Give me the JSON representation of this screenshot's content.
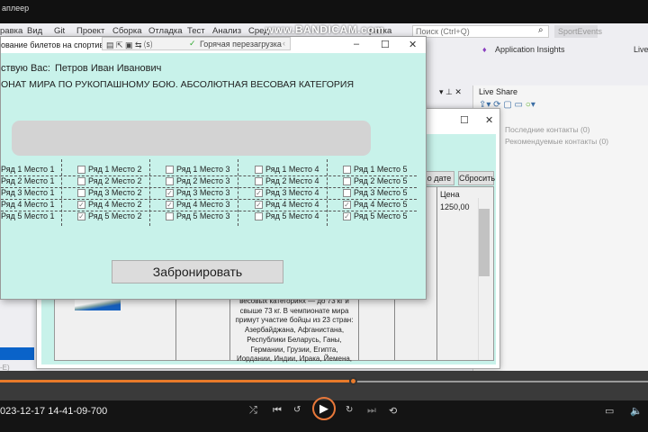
{
  "player": {
    "title": "аплеер",
    "timestamp": "023-12-17 14-41-09-700",
    "progress_percent": 54.4,
    "accent": "#e87a2a"
  },
  "vs": {
    "menu": [
      "равка",
      "Вид",
      "Git",
      "Проект",
      "Сборка",
      "Отладка",
      "Тест",
      "Анализ",
      "Сред",
      "равка"
    ],
    "watermark": "www.BANDICAM.com",
    "search_placeholder": "Поиск (Ctrl+Q)",
    "solution_tab": "SportEvents",
    "app_insights": "Application Insights",
    "live_btn": "Live",
    "live_share": {
      "title": "Live Share",
      "recent": "Последние контакты (0)",
      "recommended": "Рекомендуемые контакты (0)"
    },
    "left_stub": "-E)"
  },
  "back_window": {
    "filter_button": "о дате",
    "reset_button": "Сбросить",
    "price_header": "Цена",
    "price_value": "1250,00",
    "description": [
      "весовых категориях — до 73 кг и",
      "свыше 73 кг. В чемпионате мира",
      "примут участие бойцы из 23 стран:",
      "Азербайджана, Афганистана,",
      "Республики Беларусь, Ганы,",
      "Германии, Грузии, Египта,",
      "Иордании, Индии, Ирака, Йемена,"
    ]
  },
  "front_window": {
    "title": "ование билетов на спортивно",
    "hot_reload": "Горячая перезагрузка",
    "greeting": "ствую Вас:",
    "user_name": "Петров Иван Иванович",
    "event_title": "ОНАТ МИРА ПО РУКОПАШНОМУ БОЮ. АБСОЛЮТНАЯ ВЕСОВАЯ КАТЕГОРИЯ",
    "book_button": "Забронировать",
    "seats": [
      [
        {
          "label": "Ряд 1 Место 1",
          "checked": false
        },
        {
          "label": "Ряд 1 Место 2",
          "checked": false
        },
        {
          "label": "Ряд 1 Место 3",
          "checked": false
        },
        {
          "label": "Ряд 1 Место 4",
          "checked": false
        },
        {
          "label": "Ряд 1 Место 5",
          "checked": false
        }
      ],
      [
        {
          "label": "Ряд 2 Место 1",
          "checked": false
        },
        {
          "label": "Ряд 2 Место 2",
          "checked": false
        },
        {
          "label": "Ряд 2 Место 3",
          "checked": false
        },
        {
          "label": "Ряд 2 Место 4",
          "checked": false
        },
        {
          "label": "Ряд 2 Место 5",
          "checked": false
        }
      ],
      [
        {
          "label": "Ряд 3 Место 1",
          "checked": false
        },
        {
          "label": "Ряд 3 Место 2",
          "checked": false
        },
        {
          "label": "Ряд 3 Место 3",
          "checked": true
        },
        {
          "label": "Ряд 3 Место 4",
          "checked": true
        },
        {
          "label": "Ряд 3 Место 5",
          "checked": false
        }
      ],
      [
        {
          "label": "Ряд 4 Место 1",
          "checked": false
        },
        {
          "label": "Ряд 4 Место 2",
          "checked": true
        },
        {
          "label": "Ряд 4 Место 3",
          "checked": true
        },
        {
          "label": "Ряд 4 Место 4",
          "checked": true
        },
        {
          "label": "Ряд 4 Место 5",
          "checked": true
        }
      ],
      [
        {
          "label": "Ряд 5 Место 1",
          "checked": false
        },
        {
          "label": "Ряд 5 Место 2",
          "checked": true
        },
        {
          "label": "Ряд 5 Место 3",
          "checked": false
        },
        {
          "label": "Ряд 5 Место 4",
          "checked": false
        },
        {
          "label": "Ряд 5 Место 5",
          "checked": true
        }
      ]
    ]
  }
}
